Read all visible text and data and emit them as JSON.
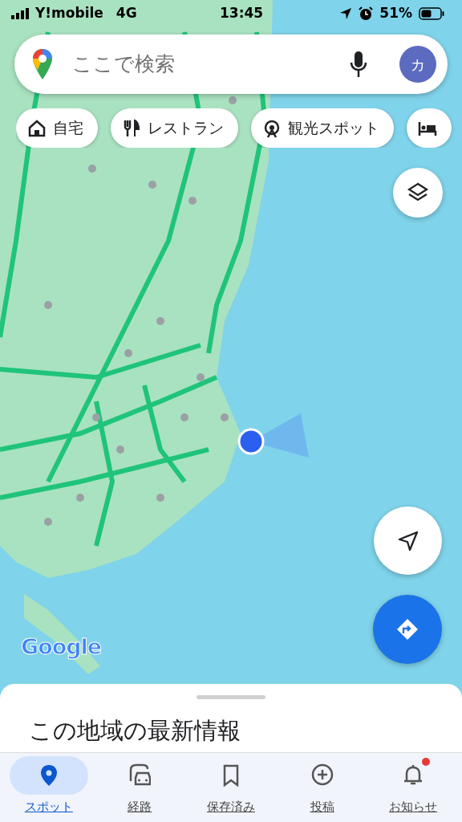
{
  "status_bar": {
    "carrier": "Y!mobile",
    "network": "4G",
    "time": "13:45",
    "battery": "51%"
  },
  "search": {
    "placeholder": "ここで検索",
    "avatar": "カ"
  },
  "chips": [
    {
      "kind": "home",
      "label": "自宅"
    },
    {
      "kind": "restaurant",
      "label": "レストラン"
    },
    {
      "kind": "attraction",
      "label": "観光スポット"
    },
    {
      "kind": "hotel"
    }
  ],
  "map": {
    "logo": "Google"
  },
  "sheet": {
    "title": "この地域の最新情報"
  },
  "nav": [
    {
      "kind": "pin",
      "label": "スポット",
      "selected": true,
      "badge": false
    },
    {
      "kind": "commute",
      "label": "経路",
      "selected": false,
      "badge": false
    },
    {
      "kind": "saved",
      "label": "保存済み",
      "selected": false,
      "badge": false
    },
    {
      "kind": "post",
      "label": "投稿",
      "selected": false,
      "badge": false
    },
    {
      "kind": "bell",
      "label": "お知らせ",
      "selected": false,
      "badge": true
    }
  ]
}
